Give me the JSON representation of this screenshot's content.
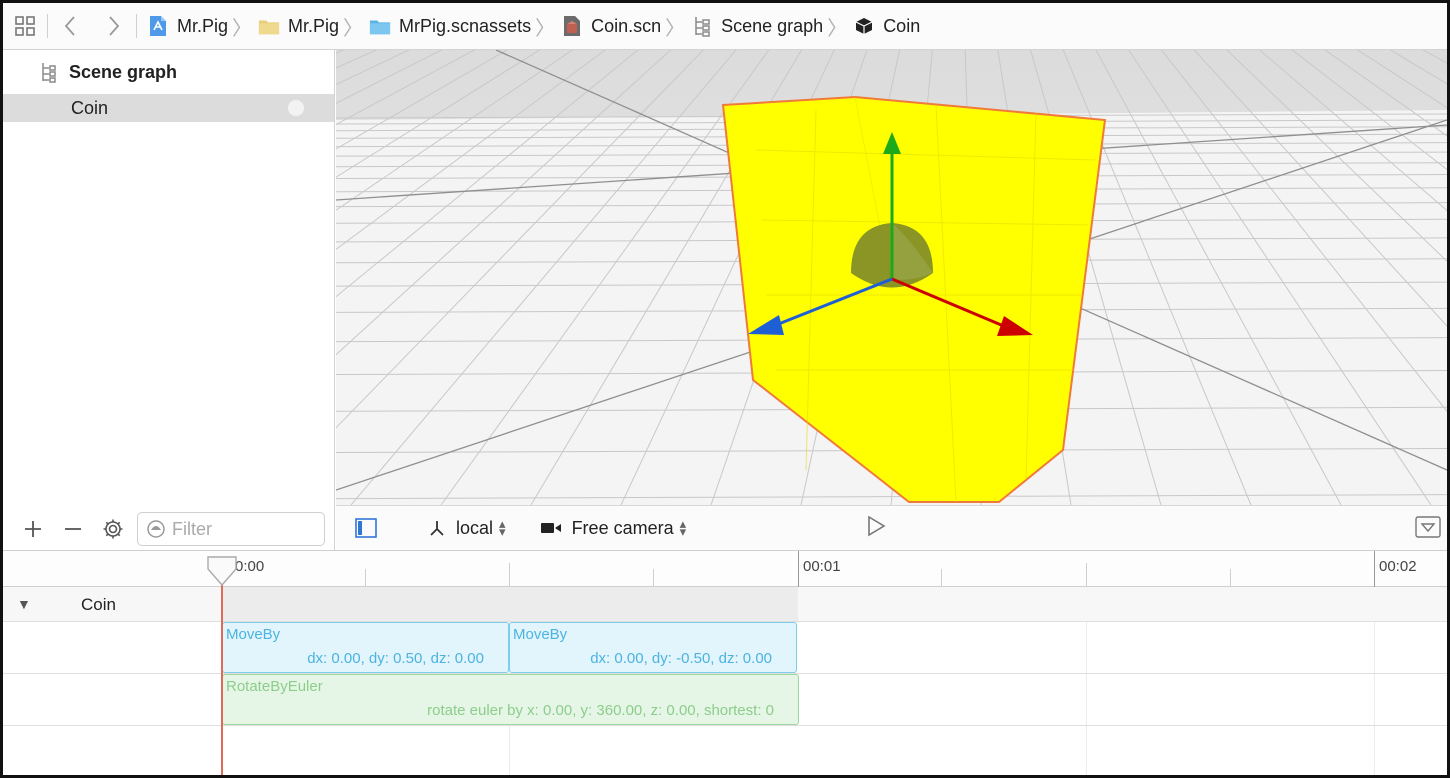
{
  "breadcrumb": {
    "items": [
      {
        "label": "Mr.Pig",
        "icon": "xcode-project-icon"
      },
      {
        "label": "Mr.Pig",
        "icon": "folder-icon"
      },
      {
        "label": "MrPig.scnassets",
        "icon": "blue-folder-icon"
      },
      {
        "label": "Coin.scn",
        "icon": "scene-file-icon"
      },
      {
        "label": "Scene graph",
        "icon": "scene-graph-icon"
      },
      {
        "label": "Coin",
        "icon": "node-cube-icon"
      }
    ]
  },
  "scene_graph": {
    "title": "Scene graph",
    "nodes": [
      {
        "label": "Coin",
        "selected": true
      }
    ],
    "filter_placeholder": "Filter"
  },
  "viewport_toolbar": {
    "coordinate_space": "local",
    "camera": "Free camera"
  },
  "timeline": {
    "ticks": [
      "0:00",
      "00:01",
      "00:02"
    ],
    "node_label": "Coin",
    "actions": [
      {
        "title": "MoveBy",
        "detail": "dx: 0.00, dy: 0.50, dz: 0.00"
      },
      {
        "title": "MoveBy",
        "detail": "dx: 0.00, dy: -0.50, dz: 0.00"
      },
      {
        "title": "RotateByEuler",
        "detail": "rotate euler by x: 0.00, y: 360.00, z: 0.00, shortest: 0"
      }
    ]
  },
  "colors": {
    "selection_fill": "#ffff00",
    "selection_outline": "#f07a3a",
    "axis_x": "#cc0000",
    "axis_y": "#1aaa1a",
    "axis_z": "#1f5fd6",
    "moveby_fill": "#e2f4fc",
    "rotate_fill": "#e6f6e6",
    "playhead": "#e06a5a"
  }
}
